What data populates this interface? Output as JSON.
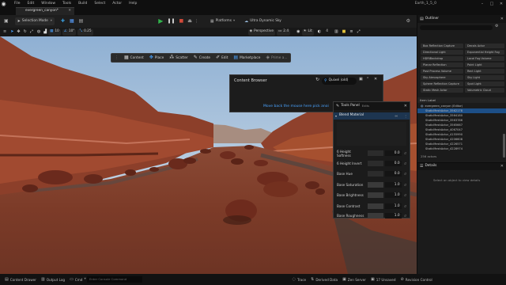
{
  "menubar": {
    "items": [
      "File",
      "Edit",
      "Window",
      "Tools",
      "Build",
      "Select",
      "Actor",
      "Help"
    ],
    "project": "Earth_1_5_0"
  },
  "level_tab": {
    "label": "evergreen_canyon*"
  },
  "main_toolbar": {
    "mode": "Selection Mode",
    "platforms": "Platforms",
    "scalability": "Ultra Dynamic Sky"
  },
  "viewport_toolbar": {
    "grid_snap": "10",
    "rotation_snap": "10°",
    "scale_snap": "0.25",
    "view_mode": "Perspective",
    "lit": "Lit",
    "camera_speed": "2.4",
    "screen_percentage": "4"
  },
  "mode_toolbar": {
    "items": [
      "Content",
      "Place",
      "Scatter",
      "Create",
      "Edit",
      "Marketplace",
      "Prime a..."
    ]
  },
  "content_browser": {
    "title": "Content Browser",
    "search": "Quixel (old)",
    "message": "Move back the mouse here pick anoi"
  },
  "tools_panel": {
    "title": "Tools Panel",
    "subtitle": "Edits",
    "material": "Blend Material",
    "props": [
      {
        "label": "6 Height Softness",
        "value": "0.0"
      },
      {
        "label": "6 Height Invert",
        "value": "0.0"
      },
      {
        "label": "Base Hue",
        "value": "0.0"
      },
      {
        "label": "Base Saturation",
        "value": "1.0"
      },
      {
        "label": "Base Brightness",
        "value": "1.0"
      },
      {
        "label": "Base Contrast",
        "value": "1.0"
      },
      {
        "label": "Base Roughness",
        "value": "1.0"
      }
    ]
  },
  "outliner": {
    "title": "Outliner",
    "chips": [
      [
        "Box Reflection Capture",
        "Decals Actor"
      ],
      [
        "Directional Light",
        "Exponential Height Fog"
      ],
      [
        "HDRIBackdrop",
        "Local Fog Volume"
      ],
      [
        "Planar Reflection",
        "Point Light"
      ],
      [
        "Post Process Volume",
        "Rect Light"
      ],
      [
        "Sky Atmosphere",
        "Sky Light"
      ],
      [
        "Sphere Reflection Capture",
        "Spot Light"
      ],
      [
        "Static Mesh Actor",
        "Volumetric Cloud"
      ]
    ],
    "filter_label": "Item Label",
    "root": "evergreen_canyon (Editor)",
    "rows": [
      "StaticMeshActor_3562178",
      "StaticMeshActor_3564180",
      "StaticMeshActor_3563786",
      "StaticMeshActor_3565667",
      "StaticMeshActor_4067047",
      "StaticMeshActor_4155990",
      "StaticMeshActor_4206608",
      "StaticMeshActor_4226571",
      "StaticMeshActor_4228974"
    ],
    "count": "256 actors"
  },
  "details": {
    "title": "Details",
    "empty": "Select an object to view details"
  },
  "statusbar": {
    "content_drawer": "Content Drawer",
    "output_log": "Output Log",
    "cmd": "Cmd",
    "console_placeholder": "Enter Console Command",
    "trace": "Trace",
    "derived_data": "Derived Data",
    "source_control": "Revision Control",
    "zen": "Zen Server",
    "unsaved": "17 Unsaved"
  },
  "colors": {
    "accent": "#2a7fd4",
    "selection": "#1d4f87",
    "play": "#31b24b"
  }
}
